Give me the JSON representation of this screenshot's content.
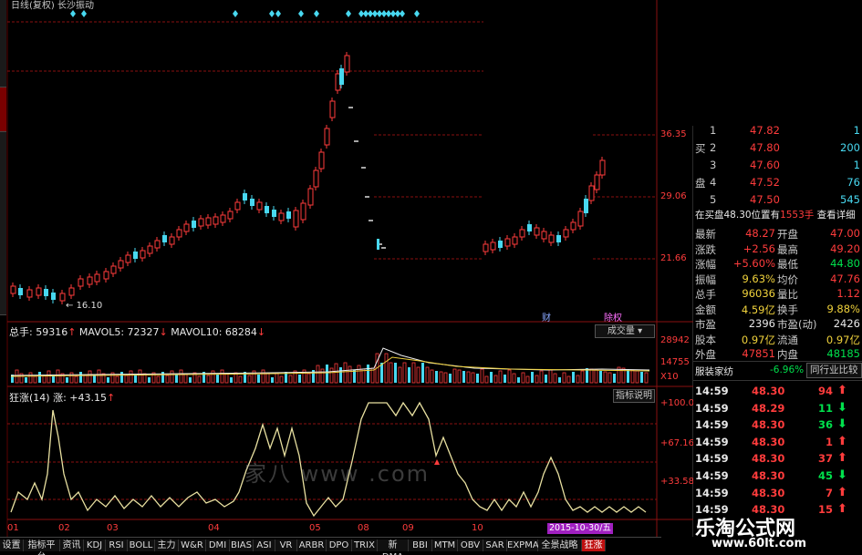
{
  "chart_title": "日线(复权) 长沙振动",
  "price_axis": [
    "36.35",
    "29.06",
    "21.66"
  ],
  "low_label": "16.10",
  "flag_labels": [
    "财",
    "除权"
  ],
  "volume_header": {
    "total": "总手: 59316",
    "ma5": "MAVOL5: 72327",
    "ma10": "MAVOL10: 68284",
    "dropdown": "成交量",
    "axis": [
      "28942",
      "14755",
      "X10"
    ]
  },
  "indicator_header": {
    "name": "狂涨(14)",
    "value": "涨: +43.15",
    "help": "指标说明",
    "axis": [
      "100.0",
      "+67.16",
      "+33.58"
    ]
  },
  "date_axis": [
    "01",
    "02",
    "03",
    "04",
    "05",
    "08",
    "09",
    "10"
  ],
  "date_highlight": "2015-10-30/五",
  "order_book": [
    {
      "side": "",
      "n": "1",
      "price": "47.82",
      "vol": "1"
    },
    {
      "side": "买",
      "n": "2",
      "price": "47.80",
      "vol": "200"
    },
    {
      "side": "",
      "n": "3",
      "price": "47.60",
      "vol": "1"
    },
    {
      "side": "盘",
      "n": "4",
      "price": "47.52",
      "vol": "76"
    },
    {
      "side": "",
      "n": "5",
      "price": "47.50",
      "vol": "545"
    }
  ],
  "buy_notice": {
    "text": "在买盘48.30位置有",
    "vol": "1553手",
    "link": "查看详细"
  },
  "quote": [
    {
      "l1": "最新",
      "v1": "48.27",
      "c1": "red",
      "l2": "开盘",
      "v2": "47.00",
      "c2": "red"
    },
    {
      "l1": "涨跌",
      "v1": "+2.56",
      "c1": "red",
      "l2": "最高",
      "v2": "49.20",
      "c2": "red"
    },
    {
      "l1": "涨幅",
      "v1": "+5.60%",
      "c1": "red",
      "l2": "最低",
      "v2": "44.80",
      "c2": "grn"
    },
    {
      "l1": "振幅",
      "v1": "9.63%",
      "c1": "yel",
      "l2": "均价",
      "v2": "47.76",
      "c2": "red"
    },
    {
      "l1": "总手",
      "v1": "96036",
      "c1": "yel",
      "l2": "量比",
      "v2": "1.12",
      "c2": "red"
    },
    {
      "l1": "金额",
      "v1": "4.59亿",
      "c1": "yel",
      "l2": "换手",
      "v2": "9.88%",
      "c2": "yel"
    },
    {
      "l1": "市盈",
      "v1": "2396",
      "c1": "wht",
      "l2": "市盈(动)",
      "v2": "2426",
      "c2": "wht"
    },
    {
      "l1": "股本",
      "v1": "0.97亿",
      "c1": "yel",
      "l2": "流通",
      "v2": "0.97亿",
      "c2": "yel"
    },
    {
      "l1": "外盘",
      "v1": "47851",
      "c1": "red",
      "l2": "内盘",
      "v2": "48185",
      "c2": "grn"
    }
  ],
  "industry": {
    "name": "服装家纺",
    "change": "-6.96%",
    "button": "同行业比较"
  },
  "ticks": [
    {
      "t": "14:59",
      "p": "48.30",
      "v": "94",
      "d": "up"
    },
    {
      "t": "14:59",
      "p": "48.29",
      "v": "11",
      "d": "down"
    },
    {
      "t": "14:59",
      "p": "48.30",
      "v": "36",
      "d": "down"
    },
    {
      "t": "14:59",
      "p": "48.30",
      "v": "1",
      "d": "up"
    },
    {
      "t": "14:59",
      "p": "48.30",
      "v": "37",
      "d": "up"
    },
    {
      "t": "14:59",
      "p": "48.30",
      "v": "45",
      "d": "down"
    },
    {
      "t": "14:59",
      "p": "48.30",
      "v": "7",
      "d": "up"
    },
    {
      "t": "14:59",
      "p": "48.30",
      "v": "15",
      "d": "up"
    }
  ],
  "tabs": [
    "设置",
    "指标平台",
    "资讯",
    "KDJ",
    "RSI",
    "BOLL",
    "主力",
    "W&R",
    "DMI",
    "BIAS",
    "ASI",
    "VR",
    "ARBR",
    "DPO",
    "TRIX",
    "新DMA",
    "BBI",
    "MTM",
    "OBV",
    "SAR",
    "EXPMA",
    "全景战略",
    "狂涨"
  ],
  "watermark_brand": "乐淘公式网",
  "watermark_url": "www.60lt.com",
  "chart_watermark": "家八  www  .com",
  "colors": {
    "up": "#ff3c3c",
    "down": "#48d8f0",
    "line": "#e8e0a0",
    "grid": "#8a1010"
  }
}
